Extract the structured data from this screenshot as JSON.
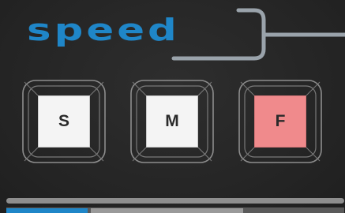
{
  "panel": {
    "title": "speed",
    "accent_color": "#1f86c8",
    "frame_color": "#9aa3ab"
  },
  "speed_buttons": [
    {
      "label": "S",
      "active": false
    },
    {
      "label": "M",
      "active": false
    },
    {
      "label": "F",
      "active": true,
      "active_color": "#f08a8c"
    }
  ],
  "progress": {
    "value": 0.24
  }
}
